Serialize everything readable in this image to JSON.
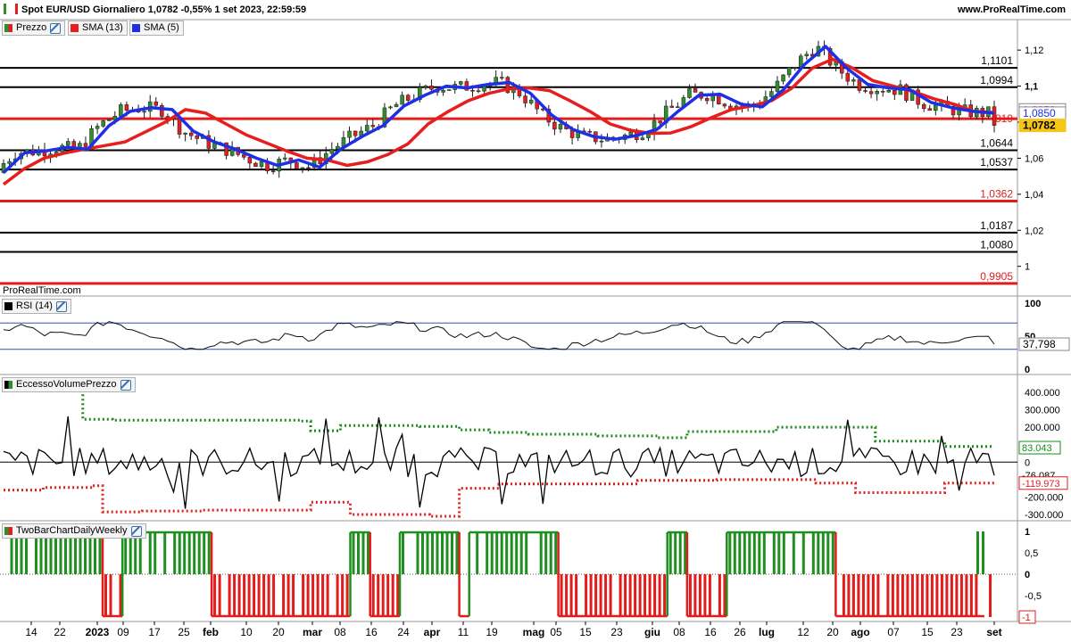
{
  "header": {
    "title": "Spot EUR/USD Giornaliero 1,0782 -0,55% 1 set 2023, 22:59:59",
    "source": "www.ProRealTime.com",
    "watermark": "ProRealTime.com"
  },
  "colors": {
    "up": "#2f8f2f",
    "down": "#e02020",
    "sma13": "#e61e1e",
    "sma5": "#1f2fe6",
    "level": "#000000",
    "level_red": "#e21b1b"
  },
  "panels": {
    "price": {
      "tags": [
        "Prezzo",
        "SMA (13)",
        "SMA (5)"
      ],
      "y_ticks": [
        "1,12",
        "1,1",
        "1,08",
        "1,06",
        "1,04",
        "1,02",
        "1"
      ],
      "levels": [
        {
          "value": "1,1101",
          "color": "black"
        },
        {
          "value": "1,0994",
          "color": "black"
        },
        {
          "value": "1,0819",
          "color": "red"
        },
        {
          "value": "1,0644",
          "color": "black"
        },
        {
          "value": "1,0537",
          "color": "black"
        },
        {
          "value": "1,0362",
          "color": "red"
        },
        {
          "value": "1,0187",
          "color": "black"
        },
        {
          "value": "1,0080",
          "color": "black"
        },
        {
          "value": "0,9905",
          "color": "red"
        }
      ],
      "last_labels": {
        "sma13": "1,0853",
        "level": "819",
        "sma5": "1,0850",
        "price": "1,0782"
      }
    },
    "rsi": {
      "tag": "RSI (14)",
      "y_ticks": [
        "100",
        "50",
        "0"
      ],
      "value": "37,798"
    },
    "evp": {
      "tag": "EccessoVolumePrezzo",
      "y_ticks": [
        "400.000",
        "300.000",
        "200.000",
        "100.000",
        "0",
        "-100.000",
        "-200.000",
        "-300.000"
      ],
      "labels": {
        "upper": "83.043",
        "mid": "-76.087",
        "lower": "-119.973"
      }
    },
    "tbc": {
      "tag": "TwoBarChartDailyWeekly",
      "y_ticks": [
        "1",
        "0,5",
        "0",
        "-0,5",
        "-1"
      ],
      "labels": {
        "upper": "1",
        "lower": "-1"
      }
    }
  },
  "x_axis": [
    "14",
    "22",
    "2023",
    "09",
    "17",
    "25",
    "feb",
    "10",
    "20",
    "mar",
    "08",
    "16",
    "24",
    "apr",
    "11",
    "19",
    "mag",
    "05",
    "15",
    "23",
    "giu",
    "08",
    "16",
    "26",
    "lug",
    "12",
    "20",
    "ago",
    "07",
    "15",
    "23",
    "set"
  ],
  "chart_data": [
    {
      "type": "candlestick",
      "title": "Spot EUR/USD Giornaliero",
      "series": [
        {
          "name": "SMA (13)",
          "values": [
            1.0455,
            1.054,
            1.06,
            1.0628,
            1.065,
            1.067,
            1.069,
            1.0745,
            1.08,
            1.087,
            1.085,
            1.079,
            1.073,
            1.0685,
            1.064,
            1.06,
            1.059,
            1.056,
            1.058,
            1.062,
            1.068,
            1.079,
            1.086,
            1.092,
            1.096,
            1.0985,
            1.099,
            1.0975,
            1.092,
            1.086,
            1.079,
            1.0755,
            1.0738,
            1.074,
            1.0775,
            1.0825,
            1.087,
            1.089,
            1.092,
            1.099,
            1.11,
            1.115,
            1.11,
            1.103,
            1.1,
            1.097,
            1.093,
            1.09,
            1.086,
            1.0853
          ]
        },
        {
          "name": "SMA (5)",
          "values": [
            1.052,
            1.063,
            1.064,
            1.066,
            1.065,
            1.078,
            1.086,
            1.088,
            1.087,
            1.075,
            1.069,
            1.065,
            1.06,
            1.056,
            1.059,
            1.055,
            1.065,
            1.072,
            1.078,
            1.089,
            1.095,
            1.1,
            1.099,
            1.101,
            1.102,
            1.096,
            1.084,
            1.076,
            1.072,
            1.0705,
            1.0725,
            1.076,
            1.086,
            1.095,
            1.0955,
            1.09,
            1.0885,
            1.098,
            1.112,
            1.122,
            1.11,
            1.101,
            1.099,
            1.098,
            1.091,
            1.088,
            1.086,
            1.085
          ]
        }
      ],
      "levels": [
        1.1101,
        1.0994,
        1.0819,
        1.0644,
        1.0537,
        1.0362,
        1.0187,
        1.008,
        0.9905
      ],
      "last": 1.0782,
      "ylim": [
        0.985,
        1.128
      ]
    },
    {
      "type": "line",
      "title": "RSI (14)",
      "last": 37.798,
      "ylim": [
        0,
        100
      ]
    },
    {
      "type": "line",
      "title": "EccessoVolumePrezzo",
      "upper": 83043,
      "mid": -76087,
      "lower": -119973,
      "ylim": [
        -300000,
        400000
      ]
    },
    {
      "type": "bar",
      "title": "TwoBarChartDailyWeekly",
      "ylim": [
        -1,
        1
      ]
    }
  ]
}
